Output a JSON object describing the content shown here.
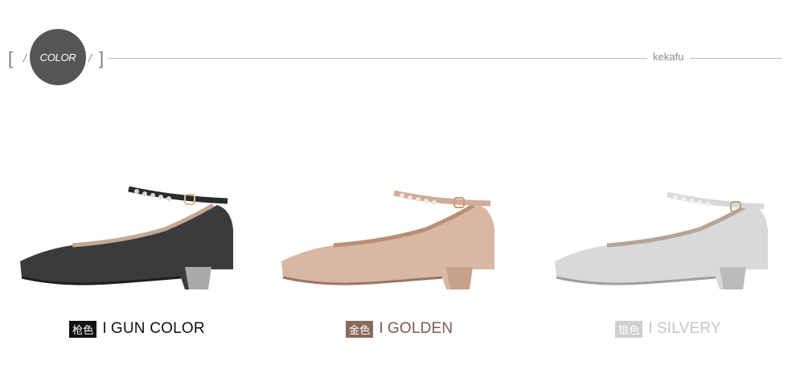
{
  "header": {
    "badge_label": "COLOR",
    "brand": "kekafu"
  },
  "products": [
    {
      "chip_text": "枪色",
      "separator": "I",
      "name": "GUN COLOR",
      "chip_color": "#111111",
      "text_color": "#111111",
      "shoe_color": "#3b3b3e"
    },
    {
      "chip_text": "金色",
      "separator": "I",
      "name": "GOLDEN",
      "chip_color": "#8a6a5d",
      "text_color": "#7a5b4f",
      "shoe_color": "#d8b7a3"
    },
    {
      "chip_text": "银色",
      "separator": "I",
      "name": "SILVERY",
      "chip_color": "#cfcfcf",
      "text_color": "#c5c5c5",
      "shoe_color": "#d7d9db"
    }
  ]
}
